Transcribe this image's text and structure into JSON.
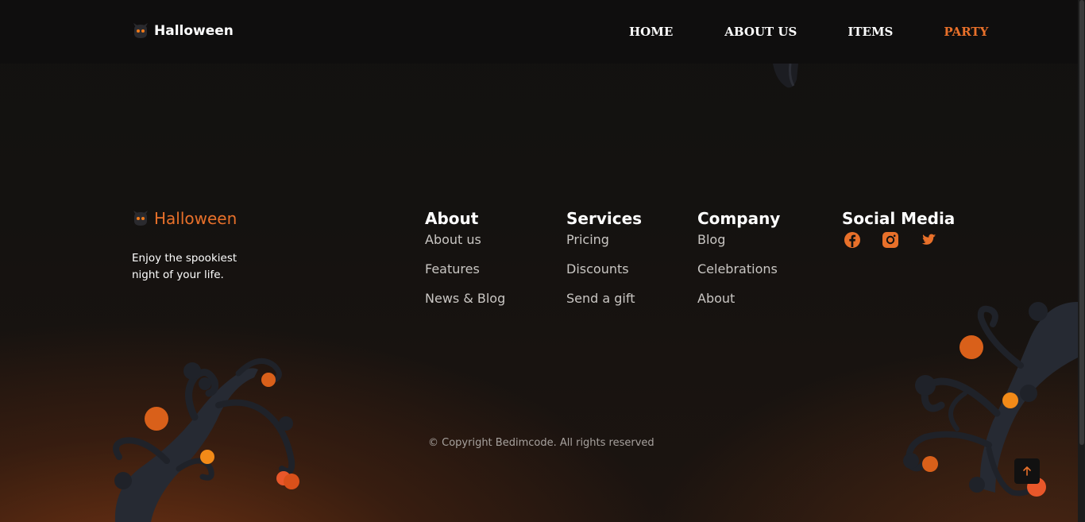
{
  "header": {
    "brand": "Halloween",
    "nav": [
      {
        "label": "Home",
        "active": false
      },
      {
        "label": "About us",
        "active": false
      },
      {
        "label": "Items",
        "active": false
      },
      {
        "label": "Party",
        "active": true
      }
    ]
  },
  "footer": {
    "brand": "Halloween",
    "tagline_line1": "Enjoy the spookiest",
    "tagline_line2": "night of your life.",
    "columns": [
      {
        "title": "About",
        "links": [
          "About us",
          "Features",
          "News & Blog"
        ]
      },
      {
        "title": "Services",
        "links": [
          "Pricing",
          "Discounts",
          "Send a gift"
        ]
      },
      {
        "title": "Company",
        "links": [
          "Blog",
          "Celebrations",
          "About"
        ]
      }
    ],
    "social": {
      "title": "Social Media",
      "icons": [
        "facebook-icon",
        "instagram-icon",
        "twitter-icon"
      ]
    },
    "copyright": "© Copyright Bedimcode. All rights reserved"
  },
  "colors": {
    "accent": "#e8702a",
    "background": "#121110",
    "header": "#0f0e0e"
  }
}
